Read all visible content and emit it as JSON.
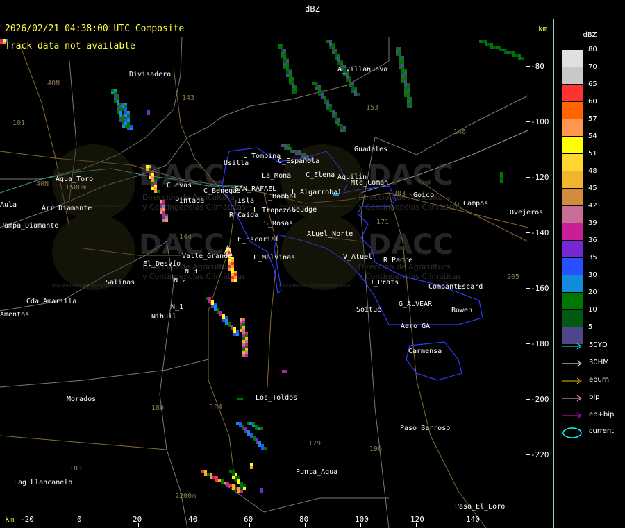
{
  "header": {
    "product": "dBZ"
  },
  "map": {
    "timestamp": "2026/02/21 04:38:00 UTC Composite",
    "track_notice": "Track data not available",
    "unit": "km",
    "y_ticks": [
      "-80",
      "-100",
      "-120",
      "-140",
      "-160",
      "-180",
      "-200",
      "-220"
    ],
    "x_ticks": [
      "-20",
      "0",
      "20",
      "40",
      "60",
      "80",
      "100",
      "120",
      "140"
    ],
    "watermark": {
      "brand": "DACC",
      "line1": "Dirección de Agricultura",
      "line2": "y Contingencias Climáticas",
      "url": "http://www.contingencias.mendoza.gov.ar"
    },
    "places": [
      "Divisadero",
      "A_Villanueva",
      "Guadales",
      "L_Tombina",
      "Usilla",
      "C_Española",
      "La_Mona",
      "C_Elena",
      "Aquilin",
      "C_Bombal",
      "Agua_Toro",
      "Pampa_Diamante",
      "Arr_Diamante",
      "C_Benegas",
      "SAN_RAFAEL",
      "L_Algarrobal",
      "Isla",
      "Pintada",
      "Cuevas",
      "R_Caída",
      "L_Tropezón",
      "Goudge",
      "S_Rosas",
      "Atuel_Norte",
      "E_Escorial",
      "Valle_Grande",
      "El_Desvío",
      "L_Malvinas",
      "Salinas",
      "Cda_Amarilla",
      "N_1",
      "N_2",
      "N_3",
      "Nihuil",
      "Soitue",
      "V_Atuel",
      "R_Padre",
      "J_Prats",
      "Bowen",
      "G_ALVEAR",
      "CompantEscard",
      "Aero_GA",
      "Carmensa",
      "Los_Toldos",
      "Morados",
      "Paso_Barroso",
      "Punta_Agua",
      "Lag_Llancanelo",
      "Paso_El_Loro",
      "Goico",
      "G_Campos",
      "Ovejeros",
      "Amentos",
      "Aula",
      "Mte_Coman"
    ],
    "roads": [
      "40N",
      "101",
      "143",
      "153",
      "146",
      "203",
      "171",
      "180",
      "179",
      "184",
      "190",
      "183",
      "205",
      "144",
      "40N",
      "1500m",
      "2200m"
    ]
  },
  "legend": {
    "title": "dBZ",
    "bins": [
      {
        "label": "80",
        "color": "#e0e0e0"
      },
      {
        "label": "70",
        "color": "#c8c8c8"
      },
      {
        "label": "65",
        "color": "#ff3232"
      },
      {
        "label": "60",
        "color": "#ff6400"
      },
      {
        "label": "57",
        "color": "#ff9650"
      },
      {
        "label": "54",
        "color": "#ffff00"
      },
      {
        "label": "51",
        "color": "#ffd732"
      },
      {
        "label": "48",
        "color": "#f0b42d"
      },
      {
        "label": "45",
        "color": "#d28c3c"
      },
      {
        "label": "42",
        "color": "#c86e96"
      },
      {
        "label": "39",
        "color": "#c81e96"
      },
      {
        "label": "36",
        "color": "#7828d2"
      },
      {
        "label": "35",
        "color": "#2850ff"
      },
      {
        "label": "30",
        "color": "#148cdc"
      },
      {
        "label": "20",
        "color": "#007800"
      },
      {
        "label": "10",
        "color": "#005a14"
      },
      {
        "label": "5",
        "color": "#50468c"
      }
    ],
    "tracks": [
      {
        "label": "50YD",
        "color": "#00ffff"
      },
      {
        "label": "30HM",
        "color": "#ffffff"
      },
      {
        "label": "eburn",
        "color": "#ffb400"
      },
      {
        "label": "bip",
        "color": "#ffb4d2"
      },
      {
        "label": "eb+bip",
        "color": "#ff00ff"
      }
    ],
    "current": {
      "label": "current",
      "color": "#00ffff"
    }
  }
}
